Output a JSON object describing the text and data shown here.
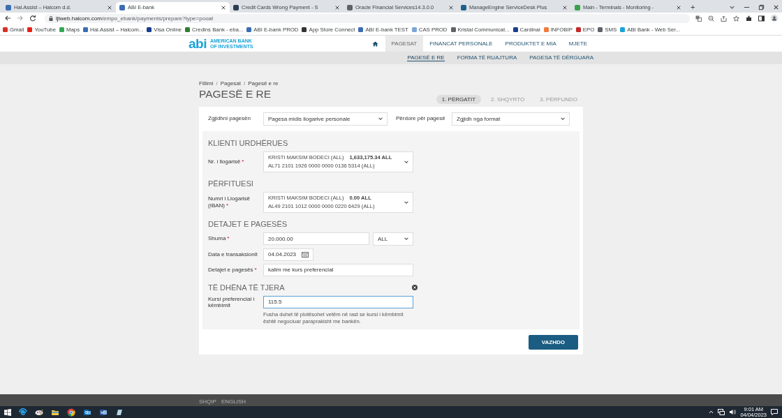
{
  "browser": {
    "tabs": [
      {
        "title": "Hal.Assist – Halcom d.d.",
        "selected": false,
        "color": "#3b6db3"
      },
      {
        "title": "ABI E-bank",
        "selected": true,
        "color": "#3b6db3"
      },
      {
        "title": "Credit Cards Wrong Payment - S",
        "selected": false,
        "color": "#2b3d52"
      },
      {
        "title": "Oracle Financial Services14.3.0.0",
        "selected": false,
        "color": "#5f6368"
      },
      {
        "title": "ManageEngine ServiceDesk Plus",
        "selected": false,
        "color": "#1f5f8b"
      },
      {
        "title": "Main - Terminals - Monitoring - ",
        "selected": false,
        "color": "#3aa14a"
      }
    ],
    "new_tab": "+",
    "url_host": "ljtweb.halcom.com",
    "url_path": "/empo_ebank/payments/prepare?type=pooat",
    "bookmarks": [
      {
        "label": "Gmail",
        "color": "#d93025"
      },
      {
        "label": "YouTube",
        "color": "#e62117"
      },
      {
        "label": "Maps",
        "color": "#34a853"
      },
      {
        "label": "Hal.Assist – Halcom...",
        "color": "#3b6db3"
      },
      {
        "label": "Visa Online",
        "color": "#1a3d8f"
      },
      {
        "label": "Credins Bank - eba...",
        "color": "#2e7d32"
      },
      {
        "label": "ABI E-bank PROD",
        "color": "#3b6db3"
      },
      {
        "label": "App Store Connect",
        "color": "#333333"
      },
      {
        "label": "ABI E-bank TEST",
        "color": "#3b6db3"
      },
      {
        "label": "CAS PROD",
        "color": "#7aa7d6"
      },
      {
        "label": "Kristal Communicat...",
        "color": "#5f6368"
      },
      {
        "label": "Cardinal",
        "color": "#1a3d8f"
      },
      {
        "label": "INFOBIP",
        "color": "#f07c3c"
      },
      {
        "label": "EPO",
        "color": "#c62828"
      },
      {
        "label": "SMS",
        "color": "#5f6368"
      },
      {
        "label": "ABI Bank - Web Ser...",
        "color": "#1aa3d9"
      }
    ]
  },
  "header": {
    "logo": "abi",
    "logo_line1": "AMERICAN BANK",
    "logo_line2": "OF INVESTMENTS",
    "nav": [
      {
        "label": "PAGESAT",
        "selected": true
      },
      {
        "label": "FINANCAT PERSONALE",
        "selected": false
      },
      {
        "label": "PRODUKTET E MIA",
        "selected": false
      },
      {
        "label": "MJETE",
        "selected": false
      }
    ],
    "subnav": [
      {
        "label": "PAGESË E RE",
        "selected": true
      },
      {
        "label": "FORMA TË RUAJTURA",
        "selected": false
      },
      {
        "label": "PAGESA TË DËRGUARA",
        "selected": false
      }
    ]
  },
  "page": {
    "breadcrumb": [
      {
        "label": "Fillimi",
        "kind": "link"
      },
      {
        "label": "/",
        "kind": "separator"
      },
      {
        "label": "Pagesat",
        "kind": "link"
      },
      {
        "label": "/",
        "kind": "separator"
      },
      {
        "label": "Pagesë e re",
        "kind": "current"
      }
    ],
    "title": "PAGESË E RE",
    "steps": [
      {
        "label": "1. PËRGATIT",
        "selected": true
      },
      {
        "label": "2. SHQYRTO",
        "selected": false
      },
      {
        "label": "3. PËRFUNDO",
        "selected": false
      }
    ],
    "top_fields": [
      {
        "label": "Zgjidhni pagesën",
        "kind": "select",
        "value": "Pagesa midis llogarive personale"
      },
      {
        "label": "Përdore për pagesë",
        "kind": "select",
        "value": "Zgjidh nga format"
      }
    ],
    "sections": [
      {
        "title": "KLIENTI URDHËRUES",
        "closable": false,
        "fields": [
          {
            "label": "Nr. i llogarisë",
            "required_mark": "*",
            "kind": "account",
            "name": "KRISTI MAKSIM BODECI (ALL)",
            "balance": "1,633,175.34 ALL",
            "iban": "AL71 2101 1926 0000 0000 0136 5314 (ALL)"
          }
        ]
      },
      {
        "title": "PËRFITUESI",
        "closable": false,
        "fields": [
          {
            "label": "Numri i Llogarisë (IBAN)",
            "required_mark": "*",
            "kind": "account",
            "name": "KRISTI MAKSIM BODECI (ALL)",
            "balance": "0.00 ALL",
            "iban": "AL49 2101 1012 0000 0000 0220 6429 (ALL)"
          }
        ]
      },
      {
        "title": "DETAJET E PAGESËS",
        "closable": false,
        "fields": [
          {
            "label": "Shuma",
            "required_mark": "*",
            "kind": "amount",
            "value": "20.000.00",
            "currency": "ALL"
          },
          {
            "label": "Data e transaksionit",
            "kind": "date",
            "value": "04.04.2023"
          },
          {
            "label": "Detajet e pagesës",
            "required_mark": "*",
            "kind": "text",
            "value": "kalim me kurs preferencial",
            "focused": false
          }
        ]
      },
      {
        "title": "TË DHËNA TË TJERA",
        "closable": true,
        "fields": [
          {
            "label": "Kursi preferencial i këmbimit",
            "kind": "text",
            "value": "115.5",
            "focused": true,
            "hint": "Fusha duhet të plotësohet vetëm në rast se kursi i këmbimit është negociuar paraprakisht me bankën."
          }
        ]
      }
    ],
    "button": "VAZHDO"
  },
  "footer": {
    "links": [
      "SHQIP",
      "ENGLISH"
    ]
  },
  "taskbar": {
    "apps": [
      {
        "kind": "ie"
      },
      {
        "kind": "paint"
      },
      {
        "kind": "folder"
      },
      {
        "kind": "chrome"
      },
      {
        "kind": "outlook"
      },
      {
        "kind": "word"
      },
      {
        "kind": "notes"
      }
    ],
    "time": "9:01 AM",
    "date": "04/04/2023"
  }
}
